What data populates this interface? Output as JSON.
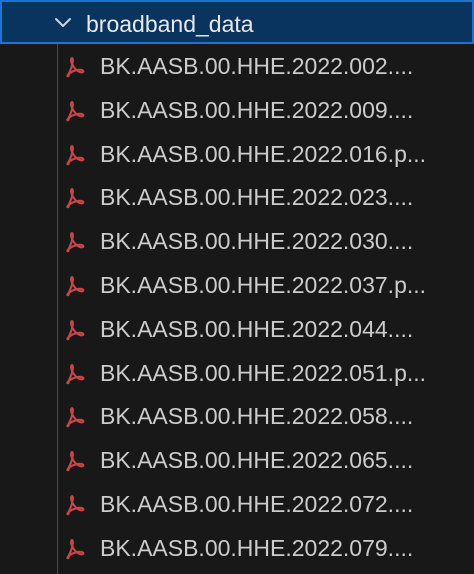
{
  "folder": {
    "name": "broadband_data",
    "expanded": true,
    "icon": "chevron-down-icon"
  },
  "files": [
    {
      "name": "BK.AASB.00.HHE.2022.002....",
      "icon": "pdf-icon"
    },
    {
      "name": "BK.AASB.00.HHE.2022.009....",
      "icon": "pdf-icon"
    },
    {
      "name": "BK.AASB.00.HHE.2022.016.p...",
      "icon": "pdf-icon"
    },
    {
      "name": "BK.AASB.00.HHE.2022.023....",
      "icon": "pdf-icon"
    },
    {
      "name": "BK.AASB.00.HHE.2022.030....",
      "icon": "pdf-icon"
    },
    {
      "name": "BK.AASB.00.HHE.2022.037.p...",
      "icon": "pdf-icon"
    },
    {
      "name": "BK.AASB.00.HHE.2022.044....",
      "icon": "pdf-icon"
    },
    {
      "name": "BK.AASB.00.HHE.2022.051.p...",
      "icon": "pdf-icon"
    },
    {
      "name": "BK.AASB.00.HHE.2022.058....",
      "icon": "pdf-icon"
    },
    {
      "name": "BK.AASB.00.HHE.2022.065....",
      "icon": "pdf-icon"
    },
    {
      "name": "BK.AASB.00.HHE.2022.072....",
      "icon": "pdf-icon"
    },
    {
      "name": "BK.AASB.00.HHE.2022.079....",
      "icon": "pdf-icon"
    }
  ],
  "colors": {
    "background": "#181818",
    "selected_row": "#0a3460",
    "focus_border": "#1b74d4",
    "pdf_icon": "#c9454a",
    "text": "#cccccc"
  }
}
